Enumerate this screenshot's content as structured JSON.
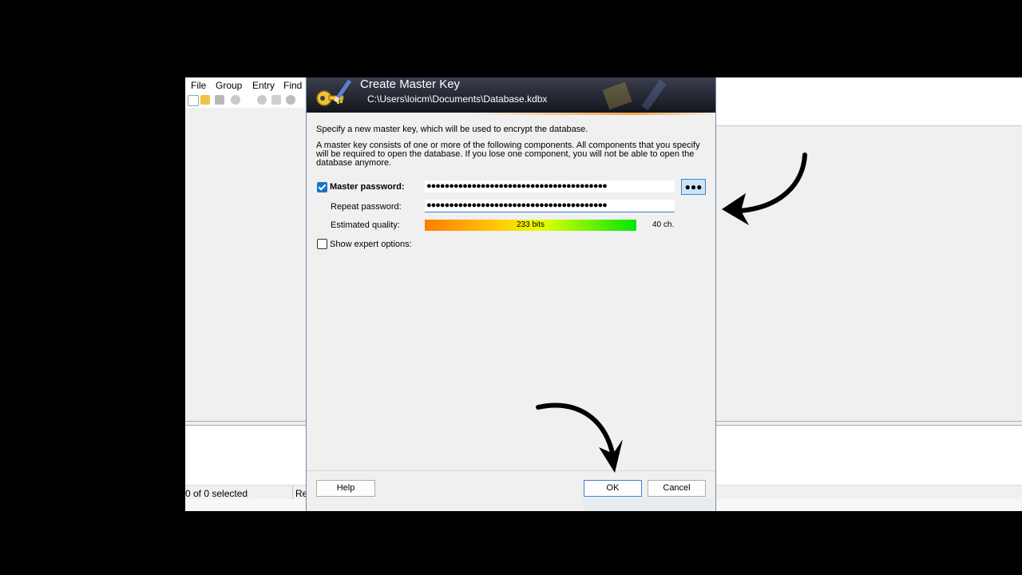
{
  "app": {
    "menu": [
      "File",
      "Group",
      "Entry",
      "Find"
    ],
    "status": {
      "selected": "0 of 0 selected",
      "extra": "Re"
    }
  },
  "dialog": {
    "title": "Create Master Key",
    "path": "C:\\Users\\loicm\\Documents\\Database.kdbx",
    "intro": "Specify a new master key, which will be used to encrypt the database.",
    "description": "A master key consists of one or more of the following components. All components that you specify will be required to open the database. If you lose one component, you will not be able to open the database anymore.",
    "master_password": {
      "checked": true,
      "label": "Master password:",
      "value": "●●●●●●●●●●●●●●●●●●●●●●●●●●●●●●●●●●●●●●●●",
      "toggle_label": "●●●"
    },
    "repeat_password": {
      "label": "Repeat password:",
      "value": "●●●●●●●●●●●●●●●●●●●●●●●●●●●●●●●●●●●●●●●●"
    },
    "quality": {
      "label": "Estimated quality:",
      "bits": "233 bits",
      "chars": "40 ch."
    },
    "expert": {
      "checked": false,
      "label": "Show expert options:"
    },
    "buttons": {
      "help": "Help",
      "ok": "OK",
      "cancel": "Cancel"
    }
  }
}
